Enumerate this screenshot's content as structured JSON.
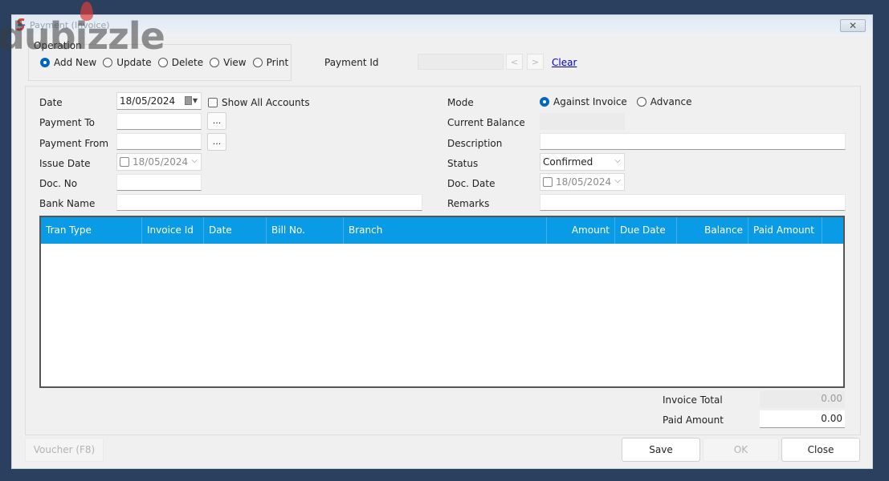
{
  "window": {
    "title": "Payment (Invoice)",
    "close_glyph": "✕"
  },
  "watermark": {
    "text": "dubizzle"
  },
  "operation": {
    "legend": "Operation",
    "options": [
      {
        "label": "Add New",
        "checked": true
      },
      {
        "label": "Update",
        "checked": false
      },
      {
        "label": "Delete",
        "checked": false
      },
      {
        "label": "View",
        "checked": false
      },
      {
        "label": "Print",
        "checked": false
      }
    ]
  },
  "payment_id": {
    "label": "Payment Id",
    "value": "",
    "prev_glyph": "<",
    "next_glyph": ">",
    "clear_label": "Clear"
  },
  "form": {
    "date": {
      "label": "Date",
      "value": "18/05/2024"
    },
    "show_all_accounts": {
      "label": "Show All Accounts",
      "checked": false
    },
    "payment_to": {
      "label": "Payment To",
      "value": "",
      "browse": "..."
    },
    "payment_from": {
      "label": "Payment From",
      "value": "",
      "browse": "..."
    },
    "issue_date": {
      "label": "Issue Date",
      "value": "18/05/2024",
      "checked": false
    },
    "doc_no": {
      "label": "Doc. No",
      "value": ""
    },
    "bank_name": {
      "label": "Bank Name",
      "value": ""
    },
    "mode": {
      "label": "Mode",
      "options": [
        {
          "label": "Against Invoice",
          "checked": true
        },
        {
          "label": "Advance",
          "checked": false
        }
      ]
    },
    "current_balance": {
      "label": "Current Balance",
      "value": ""
    },
    "description": {
      "label": "Description",
      "value": ""
    },
    "status": {
      "label": "Status",
      "value": "Confirmed"
    },
    "doc_date": {
      "label": "Doc. Date",
      "value": "18/05/2024",
      "checked": false
    },
    "remarks": {
      "label": "Remarks",
      "value": ""
    }
  },
  "grid": {
    "columns": [
      "Tran Type",
      "Invoice Id",
      "Date",
      "Bill No.",
      "Branch",
      "Amount",
      "Due Date",
      "Balance",
      "Paid Amount"
    ],
    "rows": [],
    "header_color": "#0a9be6"
  },
  "summary": {
    "invoice_total": {
      "label": "Invoice Total",
      "value": "0.00"
    },
    "paid_amount": {
      "label": "Paid Amount",
      "value": "0.00"
    }
  },
  "buttons": {
    "voucher": "Voucher (F8)",
    "save": "Save",
    "ok": "OK",
    "close": "Close"
  }
}
